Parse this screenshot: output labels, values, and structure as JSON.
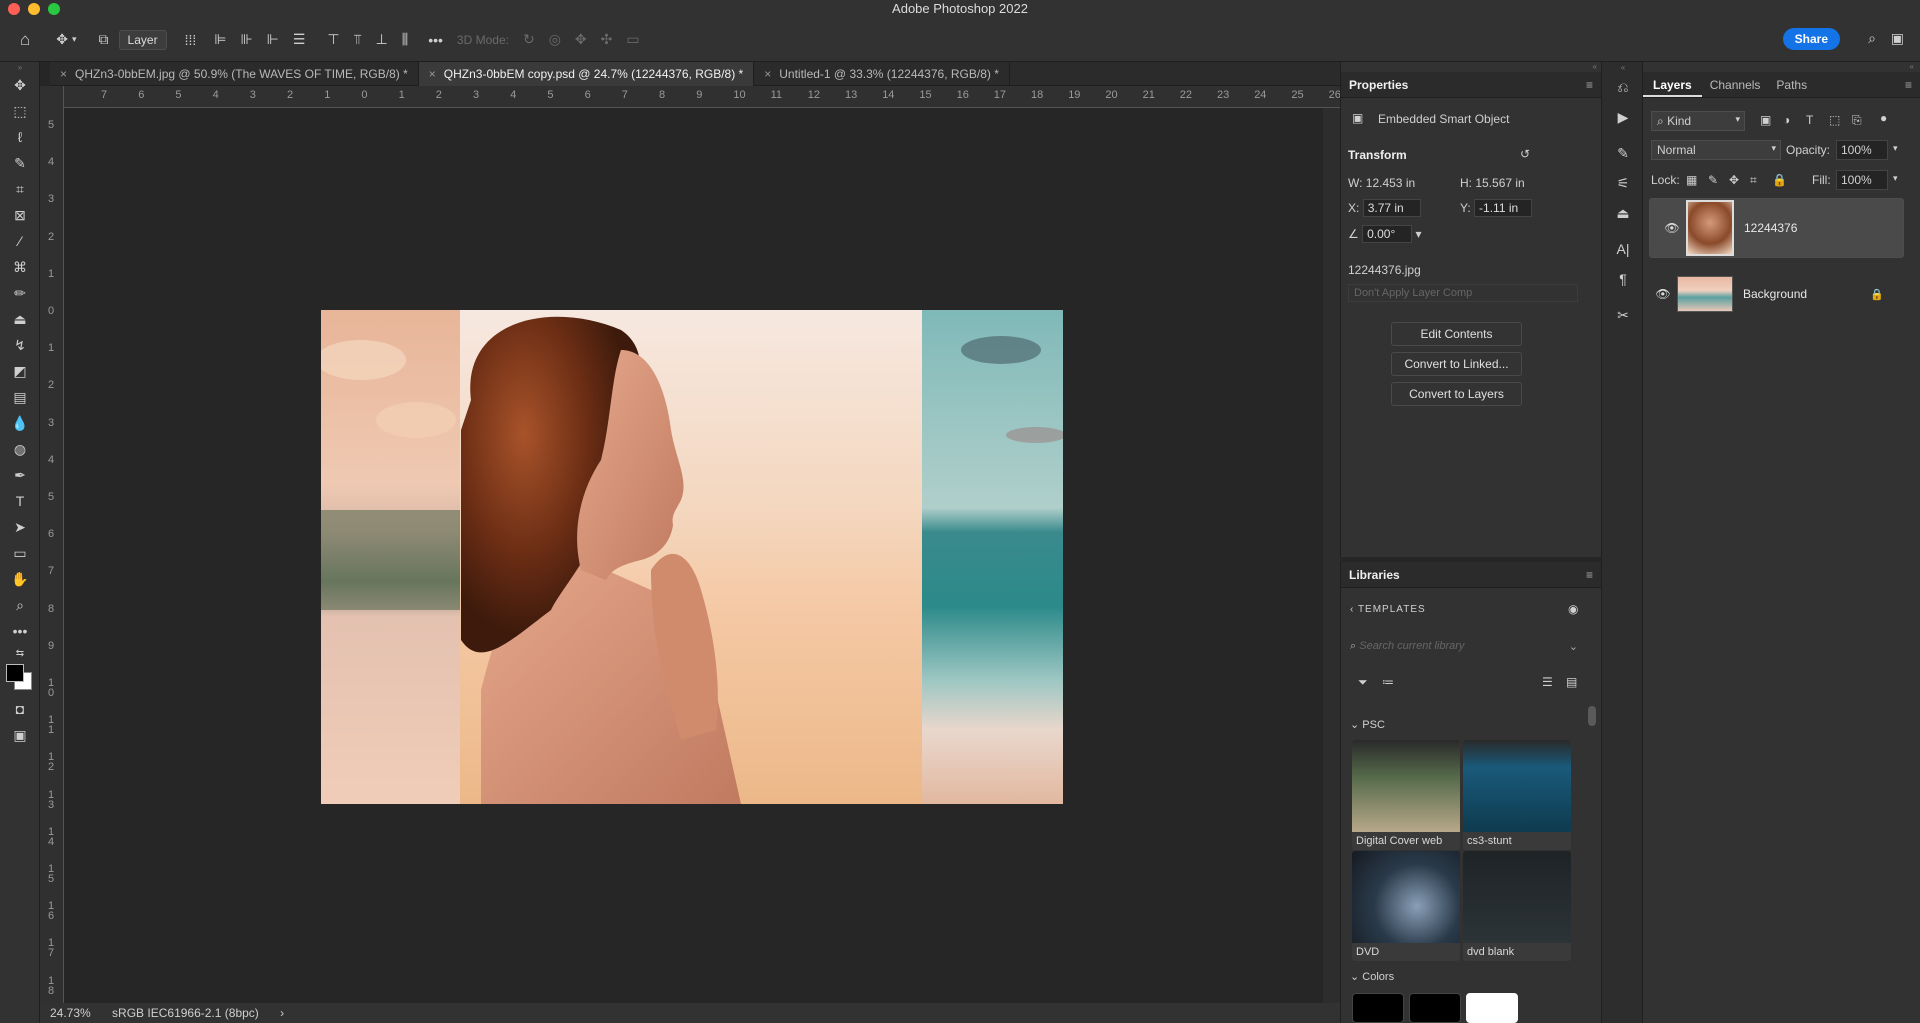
{
  "app_title": "Adobe Photoshop 2022",
  "options_bar": {
    "layer_select": "Layer",
    "mode_3d_label": "3D Mode:",
    "share_label": "Share"
  },
  "tabs": [
    {
      "label": "QHZn3-0bbEM.jpg @ 50.9% (The WAVES OF TIME, RGB/8) *"
    },
    {
      "label": "QHZn3-0bbEM copy.psd @ 24.7% (12244376, RGB/8) *"
    },
    {
      "label": "Untitled-1 @ 33.3% (12244376, RGB/8) *"
    }
  ],
  "ruler": {
    "h_ticks": [
      "7",
      "6",
      "5",
      "4",
      "3",
      "2",
      "1",
      "0",
      "1",
      "2",
      "3",
      "4",
      "5",
      "6",
      "7",
      "8",
      "9",
      "10",
      "11",
      "12",
      "13",
      "14",
      "15",
      "16",
      "17",
      "18",
      "19",
      "20",
      "21",
      "22",
      "23",
      "24",
      "25",
      "26"
    ],
    "v_ticks": [
      "5",
      "4",
      "3",
      "2",
      "1",
      "0",
      "1",
      "2",
      "3",
      "4",
      "5",
      "6",
      "7",
      "8",
      "9",
      "1\n0",
      "1\n1",
      "1\n2",
      "1\n3",
      "1\n4",
      "1\n5",
      "1\n6",
      "1\n7",
      "1\n8"
    ]
  },
  "status": {
    "zoom": "24.73%",
    "profile": "sRGB IEC61966-2.1 (8bpc)",
    "arrow": "›"
  },
  "properties": {
    "title": "Properties",
    "object_type": "Embedded Smart Object",
    "transform_label": "Transform",
    "w": "W: 12.453 in",
    "h": "H: 15.567 in",
    "x_label": "X:",
    "x_value": "3.77 in",
    "y_label": "Y:",
    "y_value": "-1.11 in",
    "angle": "0.00°",
    "filename": "12244376.jpg",
    "layer_comp": "Don't Apply Layer Comp",
    "buttons": [
      "Edit Contents",
      "Convert to Linked...",
      "Convert to Layers"
    ]
  },
  "libraries": {
    "title": "Libraries",
    "breadcrumb": "TEMPLATES",
    "search_placeholder": "Search current library",
    "psc_label": "PSC",
    "items": [
      {
        "label": "Digital Cover web"
      },
      {
        "label": "cs3-stunt"
      },
      {
        "label": "DVD"
      },
      {
        "label": "dvd blank"
      }
    ],
    "colors_label": "Colors",
    "swatch_colors": [
      "#000000",
      "#000000",
      "#ffffff"
    ]
  },
  "layers_panel": {
    "tabs": [
      "Layers",
      "Channels",
      "Paths"
    ],
    "filter_kind": "Kind",
    "blend_mode": "Normal",
    "opacity_label": "Opacity:",
    "opacity_value": "100%",
    "lock_label": "Lock:",
    "fill_label": "Fill:",
    "fill_value": "100%",
    "layers": [
      {
        "name": "12244376",
        "selected": true
      },
      {
        "name": "Background",
        "selected": false
      }
    ]
  },
  "colors": {
    "accent": "#1473e6",
    "panel": "#323232",
    "canvas": "#262626"
  }
}
